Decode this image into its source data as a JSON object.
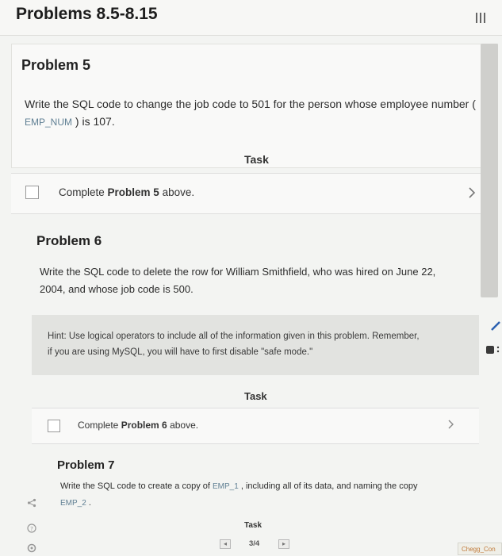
{
  "header": {
    "title": "Problems 8.5-8.15"
  },
  "problem5": {
    "heading": "Problem 5",
    "text_before": "Write the SQL code to change the job code to 501 for the person whose employee number (",
    "code": "EMP_NUM",
    "text_after": ") is 107.",
    "task_label": "Task",
    "task_prefix": "Complete ",
    "task_bold": "Problem 5",
    "task_suffix": " above."
  },
  "problem6": {
    "heading": "Problem 6",
    "text": "Write the SQL code to delete the row for William Smithfield, who was hired on June 22, 2004, and whose job code is 500.",
    "hint": "Hint: Use logical operators to include all of the information given in this problem. Remember, if you are using MySQL, you will have to first disable \"safe mode.\"",
    "task_label": "Task",
    "task_prefix": "Complete ",
    "task_bold": "Problem 6",
    "task_suffix": " above."
  },
  "problem7": {
    "heading": "Problem 7",
    "text_before": "Write the SQL code to create a copy of ",
    "code1": "EMP_1",
    "text_mid": ", including all of its data, and naming the copy ",
    "code2": "EMP_2",
    "text_after": ".",
    "task_label": "Task"
  },
  "pager": {
    "label": "3/4"
  },
  "chegg_tab": "Chegg_Con"
}
